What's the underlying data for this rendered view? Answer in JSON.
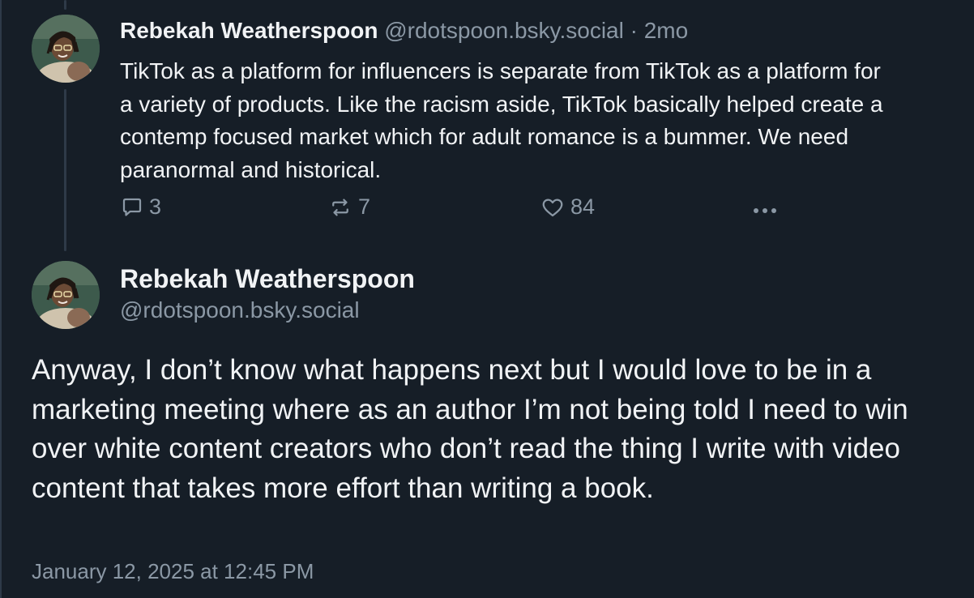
{
  "reply_post": {
    "author_name": "Rebekah Weatherspoon",
    "handle": "@rdotspoon.bsky.social",
    "separator": "·",
    "age": "2mo",
    "text": "TikTok as a platform for influencers is separate from TikTok as a platform for a variety of products. Like the racism aside, TikTok basically helped create a contemp focused market which for adult romance is a bummer. We need paranormal and historical.",
    "reply_count": "3",
    "repost_count": "7",
    "like_count": "84",
    "more_icon": "ellipsis-icon"
  },
  "main_post": {
    "author_name": "Rebekah Weatherspoon",
    "handle": "@rdotspoon.bsky.social",
    "text": "Anyway, I don’t know what happens next but I would love to be in a marketing meeting where as an author I’m not being told I need to win over white content creators who don’t read the thing I write with video content that takes more effort than writing a book.",
    "timestamp": "January 12, 2025 at 12:45 PM"
  },
  "colors": {
    "background": "#161e27",
    "text": "#f1f3f5",
    "muted": "#8b98a5",
    "thread_line": "#2e3a48"
  }
}
